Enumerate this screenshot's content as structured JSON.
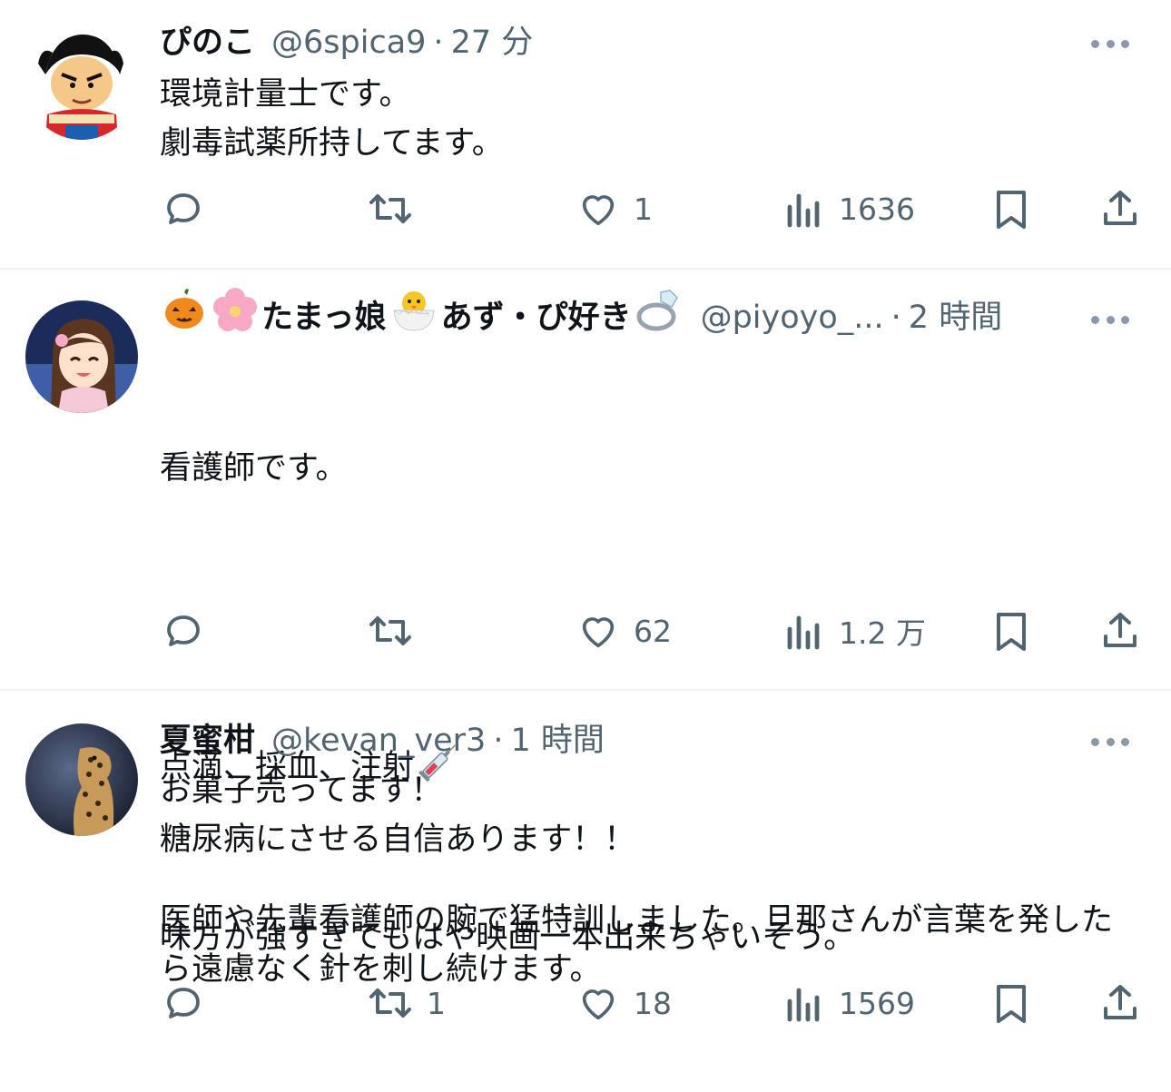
{
  "tweets": [
    {
      "name": "ぴのこ",
      "handle": "@6spica9",
      "separator": "·",
      "time": "27 分",
      "text": "環境計量士です。\n劇毒試薬所持してます。",
      "reply_count": "",
      "retweet_count": "",
      "like_count": "1",
      "view_count": "1636"
    },
    {
      "name_prefix_emojis": [
        "pumpkin-emoji",
        "cherry-blossom-emoji"
      ],
      "name": "たまっ娘",
      "name_mid_emoji": "hatching-chick-emoji",
      "name_suffix": "あず・ぴ好き",
      "name_end_emoji": "ring-emoji",
      "handle": "@piyoyo_...",
      "separator": "·",
      "time": "2 時間",
      "text_line1": "看護師です。",
      "text_line2": "点滴、採血、注射",
      "text_emoji": "syringe-emoji",
      "text_line3": "医師や先輩看護師の腕で猛特訓しました。旦那さんが言葉を発したら遠慮なく針を刺し続けます。",
      "reply_count": "",
      "retweet_count": "",
      "like_count": "62",
      "view_count": "1.2 万"
    },
    {
      "name": "夏蜜柑",
      "handle": "@kevan_ver3",
      "separator": "·",
      "time": "1 時間",
      "text": "お菓子売ってます！\n糖尿病にさせる自信あります！！\n\n味方が強すぎてもはや映画一本出来ちゃいそう。",
      "reply_count": "",
      "retweet_count": "1",
      "like_count": "18",
      "view_count": "1569"
    }
  ],
  "colors": {
    "text": "#0f1419",
    "secondary": "#536471",
    "divider": "#eff3f4"
  },
  "icons": [
    "reply-icon",
    "retweet-icon",
    "like-icon",
    "views-icon",
    "bookmark-icon",
    "share-icon",
    "more-icon"
  ]
}
